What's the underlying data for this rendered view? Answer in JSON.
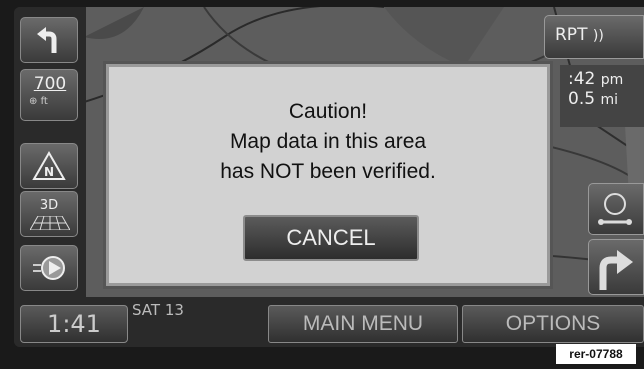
{
  "nav": {
    "scale_value": "700",
    "scale_unit": "ft",
    "view_3d_label": "3D",
    "north_label": "N"
  },
  "right": {
    "repeat_label": "RPT",
    "arrival_time": ":42",
    "arrival_unit": "pm",
    "distance_value": "0.5",
    "distance_unit": "mi"
  },
  "dialog": {
    "line1": "Caution!",
    "line2": "Map data in this area",
    "line3": "has NOT been verified.",
    "cancel_label": "CANCEL"
  },
  "bottom": {
    "clock": "1:41",
    "date": "SAT 13",
    "main_menu_label": "MAIN MENU",
    "options_label": "OPTIONS"
  },
  "reference_code": "rer-07788"
}
